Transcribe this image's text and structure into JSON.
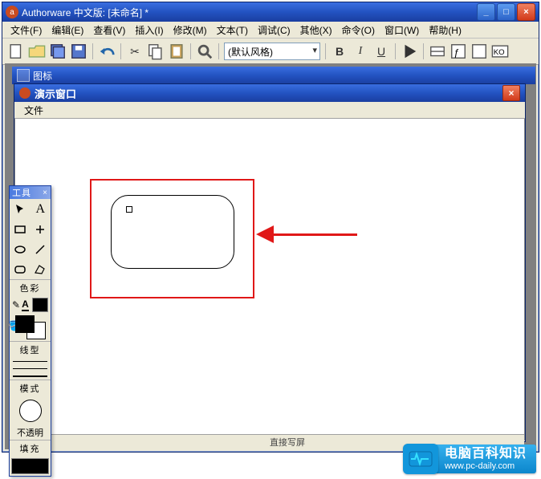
{
  "app": {
    "title": "Authorware 中文版: [未命名] *",
    "icon_glyph": "a"
  },
  "window_controls": {
    "min": "_",
    "max": "□",
    "close": "×"
  },
  "menus": [
    "文件(F)",
    "编辑(E)",
    "查看(V)",
    "插入(I)",
    "修改(M)",
    "文本(T)",
    "调试(C)",
    "其他(X)",
    "命令(O)",
    "窗口(W)",
    "帮助(H)"
  ],
  "toolbar": {
    "style_option": "(默认风格)"
  },
  "partial_window_label": "图标",
  "presentation": {
    "title": "演示窗口",
    "menu_file": "文件",
    "close": "×"
  },
  "tool_palette": {
    "title": "工具",
    "close": "×",
    "section_color": "色彩",
    "section_line": "线型",
    "section_mode": "模式",
    "mode_value": "不透明",
    "section_fill": "填充",
    "tools": {
      "pointer": "pointer",
      "text": "text",
      "rect": "rect",
      "line": "line",
      "ellipse": "ellipse",
      "poly": "poly",
      "roundrect": "roundrect",
      "diagline": "diagline"
    }
  },
  "status": {
    "text": "直接写屏"
  },
  "watermark": {
    "line1": "电脑百科知识",
    "line2": "www.pc-daily.com",
    "pulse": "∿"
  }
}
